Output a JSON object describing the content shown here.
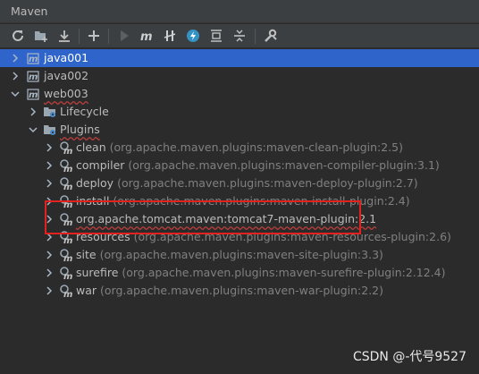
{
  "panel": {
    "title": "Maven"
  },
  "toolbar": {
    "buttons": [
      "reload-icon",
      "folder-add-icon",
      "download-icon",
      "plus-icon",
      "run-icon",
      "maven-goal-icon",
      "toggle-offline-icon",
      "skip-tests-icon",
      "show-dependencies-icon",
      "collapse-all-icon",
      "settings-icon"
    ]
  },
  "tree": {
    "projects": [
      {
        "name": "java001"
      },
      {
        "name": "java002"
      },
      {
        "name": "web003"
      }
    ],
    "lifecycle": "Lifecycle",
    "plugins": "Plugins",
    "plugin_items": [
      {
        "name": "clean",
        "artifact": "(org.apache.maven.plugins:maven-clean-plugin:2.5)"
      },
      {
        "name": "compiler",
        "artifact": "(org.apache.maven.plugins:maven-compiler-plugin:3.1)"
      },
      {
        "name": "deploy",
        "artifact": "(org.apache.maven.plugins:maven-deploy-plugin:2.7)"
      },
      {
        "name": "install",
        "artifact": "(org.apache.maven.plugins:maven-install-plugin:2.4)"
      },
      {
        "name": "org.apache.tomcat.maven:tomcat7-maven-plugin:2.1",
        "artifact": ""
      },
      {
        "name": "resources",
        "artifact": "(org.apache.maven.plugins:maven-resources-plugin:2.6)"
      },
      {
        "name": "site",
        "artifact": "(org.apache.maven.plugins:maven-site-plugin:3.3)"
      },
      {
        "name": "surefire",
        "artifact": "(org.apache.maven.plugins:maven-surefire-plugin:2.12.4)"
      },
      {
        "name": "war",
        "artifact": "(org.apache.maven.plugins:maven-war-plugin:2.2)"
      }
    ]
  },
  "gutter_char": "n",
  "watermark": "CSDN @-代号9527",
  "colors": {
    "selection": "#2f65ca",
    "highlight_box": "#e3211f",
    "background": "#2b2b2b"
  }
}
